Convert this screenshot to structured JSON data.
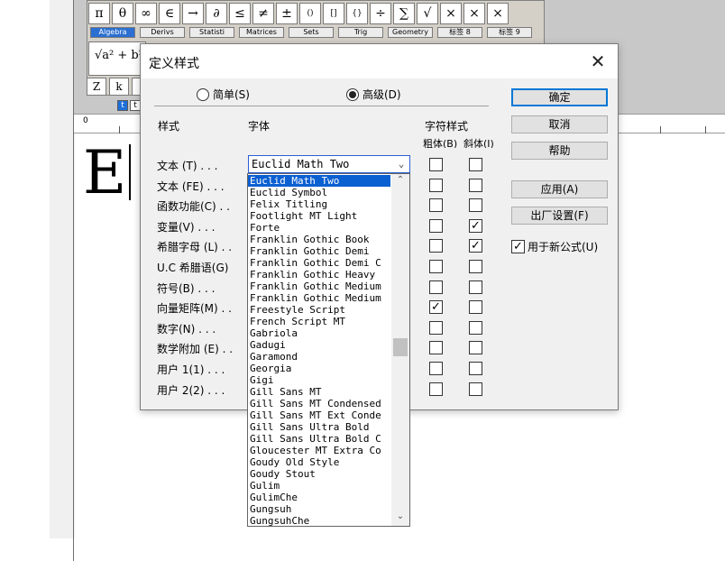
{
  "background_app": {
    "symbols": [
      "π",
      "θ",
      "∞",
      "∈",
      "→",
      "∂",
      "≤",
      "≠",
      "±",
      "()",
      "[]",
      "{}",
      "÷",
      "∑",
      "√",
      "×",
      "×",
      "×"
    ],
    "tabs": [
      "Algebra",
      "Derivs",
      "Statisti",
      "Matrices",
      "Sets",
      "Trig",
      "Geometry",
      "标签 8",
      "标签 9"
    ],
    "template_formula": "√a² + b²",
    "zk_buttons": [
      "Z",
      "k",
      "l"
    ],
    "tool_buttons": [
      "t",
      "t"
    ],
    "ruler_zero": "0",
    "document_letter": "E"
  },
  "dialog": {
    "title": "定义样式",
    "close_symbol": "✕",
    "radio_simple": "简单(S)",
    "radio_advanced": "高级(D)",
    "col_style": "样式",
    "col_font": "字体",
    "col_char_style": "字符样式",
    "col_bold": "粗体(B)",
    "col_italic": "斜体(I)",
    "rows": [
      {
        "label": "文本 (T) . . .",
        "bold": false,
        "italic": false
      },
      {
        "label": "文本 (FE) . . .",
        "bold": false,
        "italic": false
      },
      {
        "label": "函数功能(C) . .",
        "bold": false,
        "italic": false
      },
      {
        "label": "变量(V) . . .",
        "bold": false,
        "italic": true
      },
      {
        "label": "希腊字母 (L) . .",
        "bold": false,
        "italic": true
      },
      {
        "label": "U.C 希腊语(G)",
        "bold": false,
        "italic": false
      },
      {
        "label": "符号(B) . . .",
        "bold": false,
        "italic": false
      },
      {
        "label": "向量矩阵(M) . .",
        "bold": true,
        "italic": false
      },
      {
        "label": "数字(N) . . .",
        "bold": false,
        "italic": false
      },
      {
        "label": "数学附加 (E) . .",
        "bold": false,
        "italic": false
      },
      {
        "label": "用户 1(1) . . .",
        "bold": false,
        "italic": false
      },
      {
        "label": "用户 2(2) . . .",
        "bold": false,
        "italic": false
      }
    ],
    "font_combo_value": "Euclid Math Two",
    "check_symbol": "✓",
    "buttons": {
      "ok": "确定",
      "cancel": "取消",
      "help": "帮助",
      "apply": "应用(A)",
      "factory": "出厂设置(F)"
    },
    "new_formula_checkbox": "用于新公式(U)"
  },
  "font_dropdown": {
    "selected": "Euclid Math Two",
    "items": [
      "Euclid Math Two",
      "Euclid Symbol",
      "Felix Titling",
      "Footlight MT Light",
      "Forte",
      "Franklin Gothic Book",
      "Franklin Gothic Demi",
      "Franklin Gothic Demi C",
      "Franklin Gothic Heavy",
      "Franklin Gothic Medium",
      "Franklin Gothic Medium",
      "Freestyle Script",
      "French Script MT",
      "Gabriola",
      "Gadugi",
      "Garamond",
      "Georgia",
      "Gigi",
      "Gill Sans MT",
      "Gill Sans MT Condensed",
      "Gill Sans MT Ext Conde",
      "Gill Sans Ultra Bold",
      "Gill Sans Ultra Bold C",
      "Gloucester MT Extra Co",
      "Goudy Old Style",
      "Goudy Stout",
      "Gulim",
      "GulimChe",
      "Gungsuh",
      "GungsuhChe"
    ]
  }
}
